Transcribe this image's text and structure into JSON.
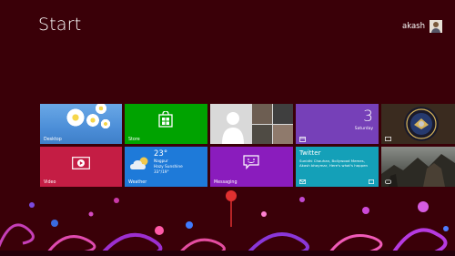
{
  "screen": {
    "title": "Start"
  },
  "user": {
    "name": "akash"
  },
  "tiles": {
    "desktop": {
      "label": "Desktop"
    },
    "store": {
      "label": "Store"
    },
    "calendar": {
      "date": "3",
      "day": "Saturday"
    },
    "video": {
      "label": "Video"
    },
    "weather": {
      "temp": "23°",
      "city": "Nagpur",
      "condition": "Hazy Sunshine",
      "range": "33°/19°",
      "label": "Weather"
    },
    "messaging": {
      "label": "Messaging"
    },
    "twitter": {
      "title": "Twitter",
      "line1": "Sunidhi Chauhan, Bollywood Memes,",
      "line2": "Akash bhaymar, Here's what's happen"
    }
  },
  "colors": {
    "background": "#3a0008",
    "store": "#00a300",
    "calendar": "#7640b8",
    "video": "#c41d44",
    "weather": "#1e7ad9",
    "messaging": "#8a1cbd",
    "twitter": "#14a0b8"
  },
  "icons": {
    "store": "shopping-bag-icon",
    "video": "play-icon",
    "messaging": "chat-bubble-icon",
    "calendar": "calendar-icon",
    "mail": "envelope-icon",
    "weather": "cloud-icon",
    "seal": "seal-icon"
  }
}
